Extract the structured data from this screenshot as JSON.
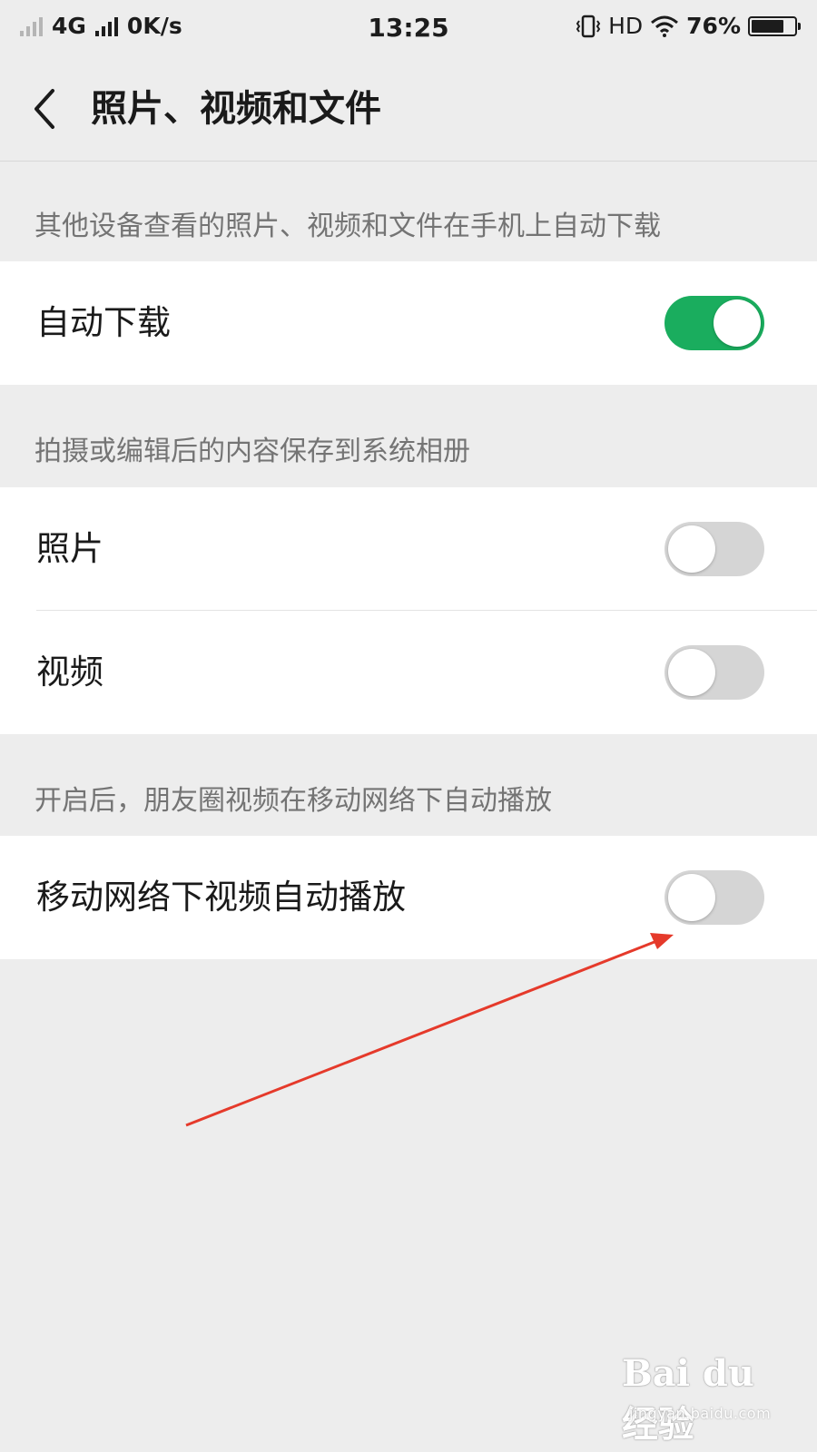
{
  "status_bar": {
    "network": "4G",
    "speed": "0K/s",
    "time": "13:25",
    "hd": "HD",
    "battery_percent": "76%",
    "battery_level": 0.76
  },
  "nav": {
    "title": "照片、视频和文件"
  },
  "sections": [
    {
      "caption": "其他设备查看的照片、视频和文件在手机上自动下载",
      "items": [
        {
          "label": "自动下载",
          "on": true
        }
      ]
    },
    {
      "caption": "拍摄或编辑后的内容保存到系统相册",
      "items": [
        {
          "label": "照片",
          "on": false
        },
        {
          "label": "视频",
          "on": false
        }
      ]
    },
    {
      "caption": "开启后，朋友圈视频在移动网络下自动播放",
      "items": [
        {
          "label": "移动网络下视频自动播放",
          "on": false
        }
      ]
    }
  ],
  "colors": {
    "switch_on": "#1aad5e",
    "switch_off": "#d5d5d5",
    "arrow": "#e53a2b",
    "background": "#ededed"
  },
  "watermark": {
    "brand": "Bai du 经验",
    "url": "jingyan.baidu.com"
  }
}
